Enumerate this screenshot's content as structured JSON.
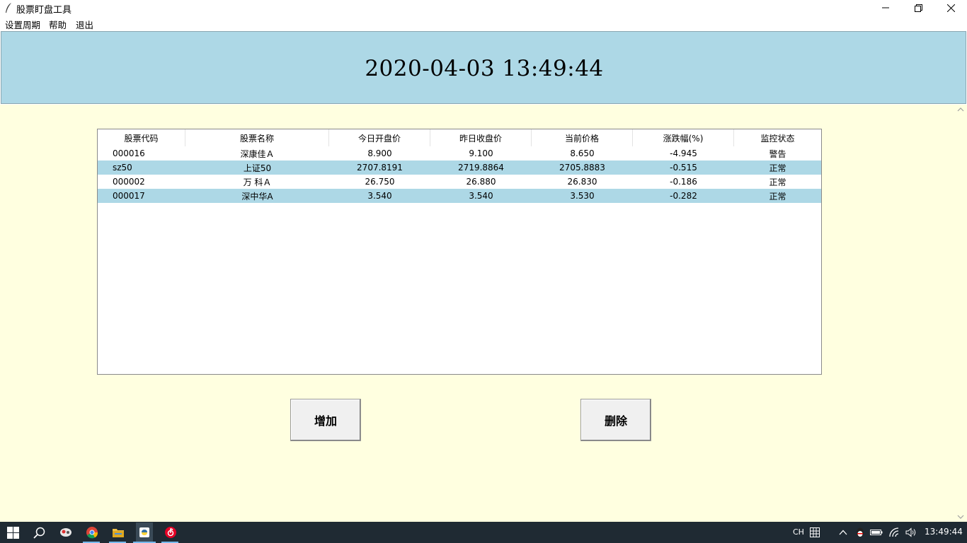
{
  "window": {
    "title": "股票盯盘工具"
  },
  "menu": {
    "items": [
      "设置周期",
      "帮助",
      "退出"
    ]
  },
  "clock": {
    "datetime": "2020-04-03 13:49:44",
    "panel_color": "#add8e6"
  },
  "table": {
    "columns": [
      "股票代码",
      "股票名称",
      "今日开盘价",
      "昨日收盘价",
      "当前价格",
      "涨跌幅(%)",
      "监控状态"
    ],
    "rows": [
      [
        "000016",
        "深康佳Ａ",
        "8.900",
        "9.100",
        "8.650",
        "-4.945",
        "警告"
      ],
      [
        "sz50",
        "上证50",
        "2707.8191",
        "2719.8864",
        "2705.8883",
        "-0.515",
        "正常"
      ],
      [
        "000002",
        "万 科Ａ",
        "26.750",
        "26.880",
        "26.830",
        "-0.186",
        "正常"
      ],
      [
        "000017",
        "深中华A",
        "3.540",
        "3.540",
        "3.530",
        "-0.282",
        "正常"
      ]
    ],
    "alt_row_color": "#add8e6"
  },
  "buttons": {
    "add_label": "增加",
    "delete_label": "删除"
  },
  "taskbar": {
    "ime_label": "CH",
    "clock": "13:49:44",
    "icons": [
      "windows-start-icon",
      "search-icon",
      "app-icon",
      "chrome-icon",
      "file-explorer-icon",
      "python-icon",
      "netease-music-icon"
    ]
  },
  "colors": {
    "main_background": "#ffffe0",
    "taskbar": "#1f2a33"
  }
}
